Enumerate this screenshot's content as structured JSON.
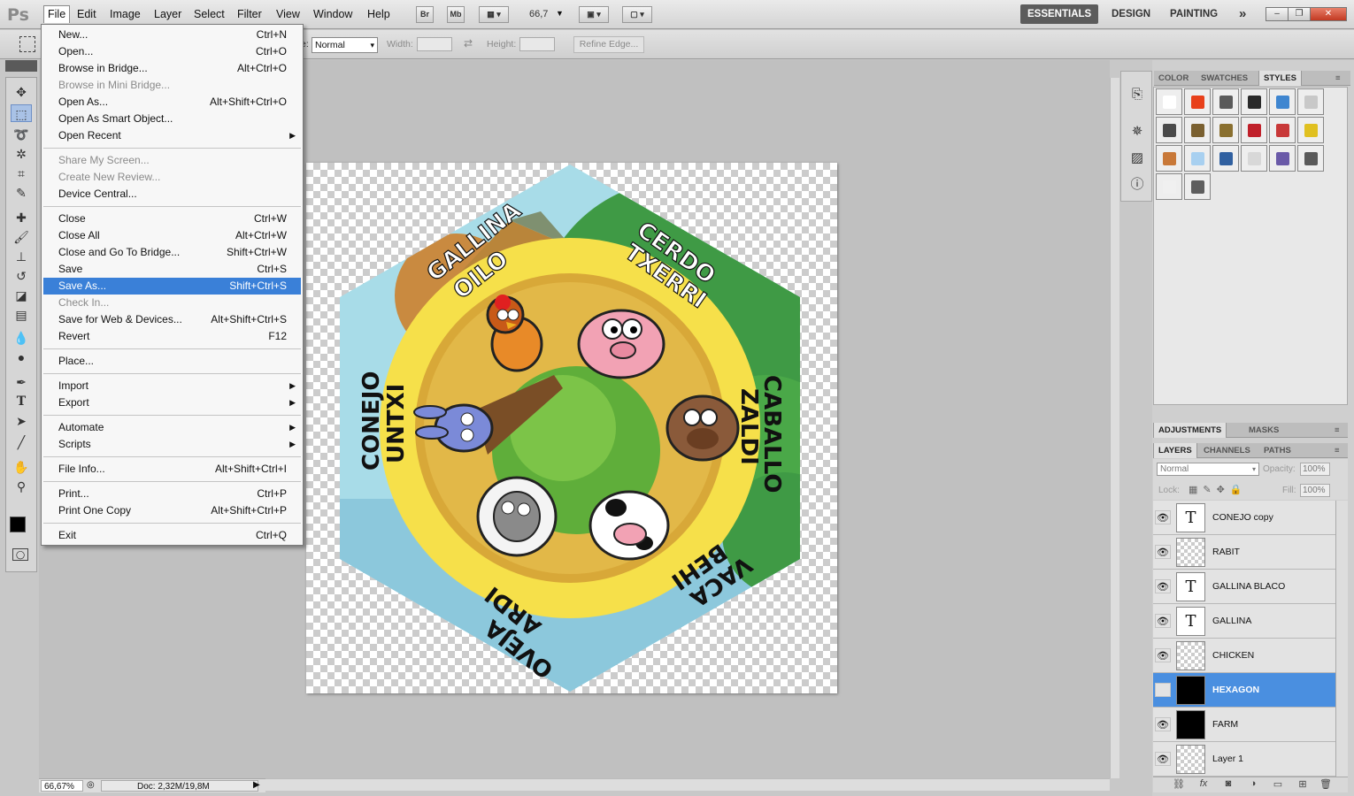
{
  "app": {
    "logo": "Ps"
  },
  "menubar": {
    "items": [
      "File",
      "Edit",
      "Image",
      "Layer",
      "Select",
      "Filter",
      "View",
      "Window",
      "Help"
    ],
    "bridge_btn": "Br",
    "minibridge_btn": "Mb",
    "zoom_value": "66,7",
    "workspaces": [
      "ESSENTIALS",
      "DESIGN",
      "PAINTING"
    ],
    "more": "»"
  },
  "options": {
    "style_value": "Normal",
    "width_label": "Width:",
    "height_label": "Height:",
    "refine_edge": "Refine Edge...",
    "prefix": "e:"
  },
  "filemenu": {
    "items": [
      {
        "label": "New...",
        "shortcut": "Ctrl+N"
      },
      {
        "label": "Open...",
        "shortcut": "Ctrl+O"
      },
      {
        "label": "Browse in Bridge...",
        "shortcut": "Alt+Ctrl+O"
      },
      {
        "label": "Browse in Mini Bridge...",
        "shortcut": ""
      },
      {
        "label": "Open As...",
        "shortcut": "Alt+Shift+Ctrl+O"
      },
      {
        "label": "Open As Smart Object...",
        "shortcut": ""
      },
      {
        "label": "Open Recent",
        "shortcut": ""
      },
      {
        "label": "Share My Screen...",
        "shortcut": ""
      },
      {
        "label": "Create New Review...",
        "shortcut": ""
      },
      {
        "label": "Device Central...",
        "shortcut": ""
      },
      {
        "label": "Close",
        "shortcut": "Ctrl+W"
      },
      {
        "label": "Close All",
        "shortcut": "Alt+Ctrl+W"
      },
      {
        "label": "Close and Go To Bridge...",
        "shortcut": "Shift+Ctrl+W"
      },
      {
        "label": "Save",
        "shortcut": "Ctrl+S"
      },
      {
        "label": "Save As...",
        "shortcut": "Shift+Ctrl+S"
      },
      {
        "label": "Check In...",
        "shortcut": ""
      },
      {
        "label": "Save for Web & Devices...",
        "shortcut": "Alt+Shift+Ctrl+S"
      },
      {
        "label": "Revert",
        "shortcut": "F12"
      },
      {
        "label": "Place...",
        "shortcut": ""
      },
      {
        "label": "Import",
        "shortcut": ""
      },
      {
        "label": "Export",
        "shortcut": ""
      },
      {
        "label": "Automate",
        "shortcut": ""
      },
      {
        "label": "Scripts",
        "shortcut": ""
      },
      {
        "label": "File Info...",
        "shortcut": "Alt+Shift+Ctrl+I"
      },
      {
        "label": "Print...",
        "shortcut": "Ctrl+P"
      },
      {
        "label": "Print One Copy",
        "shortcut": "Alt+Shift+Ctrl+P"
      },
      {
        "label": "Exit",
        "shortcut": "Ctrl+Q"
      }
    ]
  },
  "canvas_labels": {
    "gallina": "GALLINA",
    "oilo": "OILO",
    "cerdo": "CERDO",
    "txerri": "TXERRI",
    "caballo": "CABALLO",
    "zaldi": "ZALDI",
    "vaca": "VACA",
    "behi": "BEHI",
    "oveja": "OVEJA",
    "ardi": "ARDI",
    "conejo": "CONEJO",
    "untxi": "UNTXI"
  },
  "panels": {
    "top_tabs": [
      "COLOR",
      "SWATCHES",
      "STYLES"
    ],
    "adj_tabs": [
      "ADJUSTMENTS",
      "MASKS"
    ],
    "layer_tabs": [
      "LAYERS",
      "CHANNELS",
      "PATHS"
    ],
    "blend_mode": "Normal",
    "opacity_label": "Opacity:",
    "opacity_value": "100%",
    "lock_label": "Lock:",
    "fill_label": "Fill:",
    "fill_value": "100%",
    "swatch_colors": [
      "#ffffff",
      "#e8401a",
      "#5a5a5a",
      "#2a2a2a",
      "#3f86d0",
      "#c8c8c8",
      "#4a4a4a",
      "#7a6030",
      "#8a7030",
      "#c0202a",
      "#c83838",
      "#e0c020",
      "#c87838",
      "#a8d0f0",
      "#3060a0",
      "#d8d8d8",
      "#6a5aa8",
      "#5a5a5a",
      "#f0f0f0",
      "#5e5e5e"
    ]
  },
  "layers": [
    {
      "name": "CONEJO copy",
      "type": "text",
      "visible": true
    },
    {
      "name": "RABIT",
      "type": "raster",
      "visible": true
    },
    {
      "name": "GALLINA BLACO",
      "type": "text",
      "visible": true
    },
    {
      "name": "GALLINA",
      "type": "text",
      "visible": true
    },
    {
      "name": "CHICKEN",
      "type": "raster",
      "visible": true
    },
    {
      "name": "HEXAGON",
      "type": "fill",
      "visible": false,
      "selected": true
    },
    {
      "name": "FARM",
      "type": "fill",
      "visible": true
    },
    {
      "name": "Layer 1",
      "type": "raster",
      "visible": true
    }
  ],
  "status": {
    "zoom": "66,67%",
    "doc": "Doc: 2,32M/19,8M"
  }
}
